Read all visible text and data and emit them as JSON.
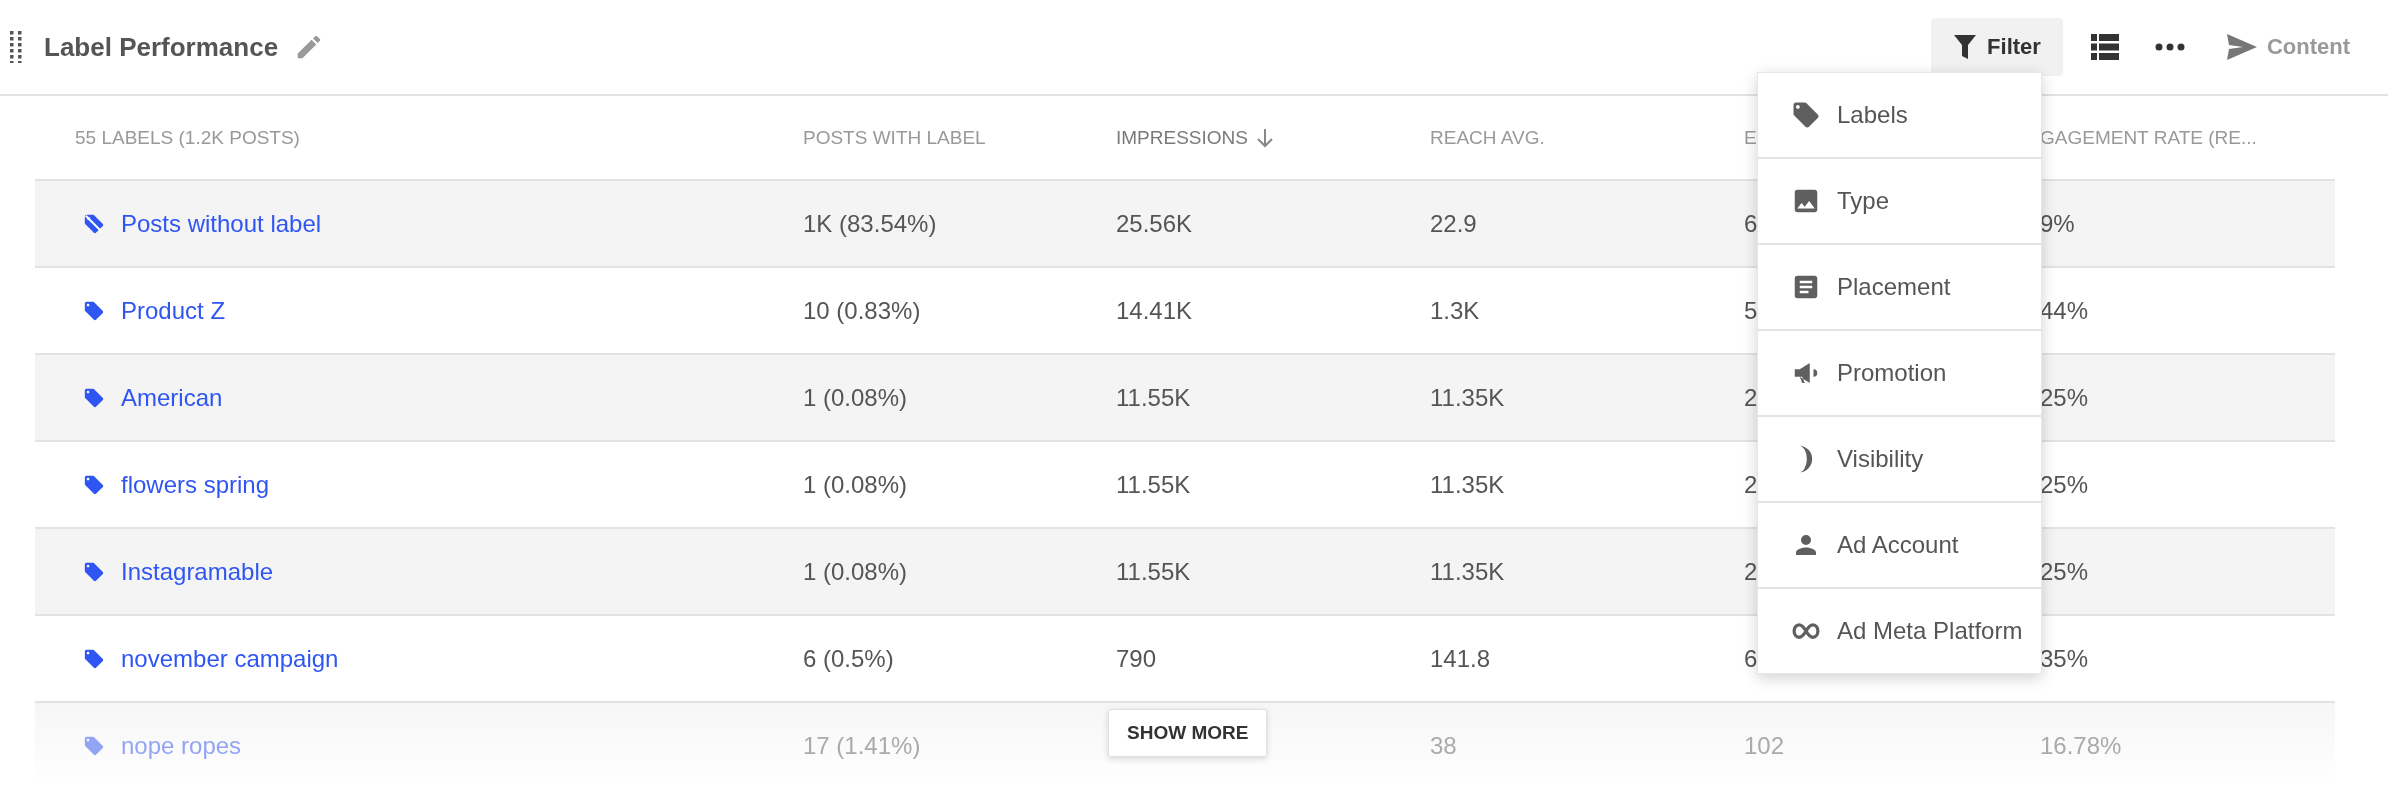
{
  "widget": {
    "title": "Label Performance"
  },
  "toolbar": {
    "filter": {
      "label": "Filter",
      "open": true
    },
    "content": {
      "label": "Content",
      "disabled": true
    }
  },
  "table": {
    "columns": [
      {
        "label": "55 LABELS (1.2K POSTS)",
        "sorted": false
      },
      {
        "label": "POSTS WITH LABEL",
        "sorted": false
      },
      {
        "label": "IMPRESSIONS",
        "sorted": true
      },
      {
        "label": "REACH AVG.",
        "sorted": false
      },
      {
        "label": "E",
        "sorted": false
      },
      {
        "label": "GAGEMENT RATE (RE...",
        "sorted": false
      }
    ],
    "rows": [
      {
        "kind": "unlabeled",
        "faded": false,
        "cells": [
          "Posts without label",
          "1K (83.54%)",
          "25.56K",
          "22.9",
          "6",
          "9%"
        ]
      },
      {
        "kind": "label",
        "faded": false,
        "cells": [
          "Product Z",
          "10 (0.83%)",
          "14.41K",
          "1.3K",
          "5",
          "44%"
        ]
      },
      {
        "kind": "label",
        "faded": false,
        "cells": [
          "American",
          "1 (0.08%)",
          "11.55K",
          "11.35K",
          "2",
          "25%"
        ]
      },
      {
        "kind": "label",
        "faded": false,
        "cells": [
          "flowers spring",
          "1 (0.08%)",
          "11.55K",
          "11.35K",
          "2",
          "25%"
        ]
      },
      {
        "kind": "label",
        "faded": false,
        "cells": [
          "Instagramable",
          "1 (0.08%)",
          "11.55K",
          "11.35K",
          "2",
          "25%"
        ]
      },
      {
        "kind": "label",
        "faded": false,
        "cells": [
          "november campaign",
          "6 (0.5%)",
          "790",
          "141.8",
          "6",
          "35%"
        ]
      },
      {
        "kind": "label",
        "faded": true,
        "cells": [
          "nope ropes",
          "17 (1.41%)",
          "",
          "38",
          "102",
          "16.78%"
        ]
      }
    ],
    "show_more": "SHOW MORE"
  },
  "filter_menu": {
    "items": [
      "Labels",
      "Type",
      "Placement",
      "Promotion",
      "Visibility",
      "Ad Account",
      "Ad Meta Platform"
    ]
  }
}
